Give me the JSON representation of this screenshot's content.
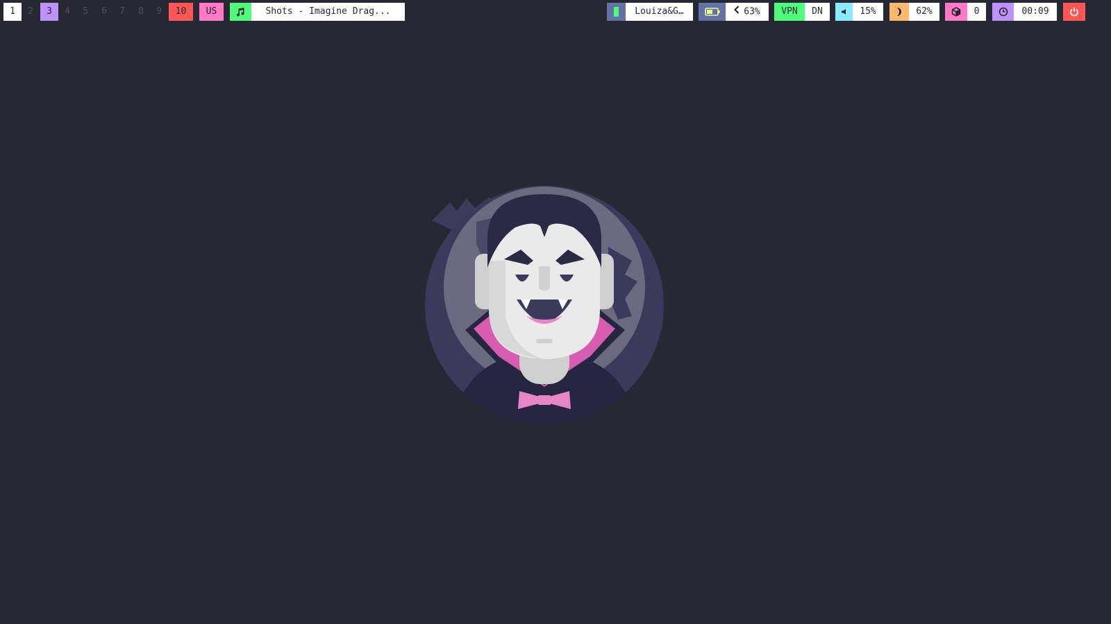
{
  "workspaces": [
    {
      "label": "1",
      "state": "focused",
      "color": "#ffffff"
    },
    {
      "label": "2",
      "state": "empty"
    },
    {
      "label": "3",
      "state": "occupied",
      "color": "#bd93f9"
    },
    {
      "label": "4",
      "state": "empty"
    },
    {
      "label": "5",
      "state": "empty"
    },
    {
      "label": "6",
      "state": "empty"
    },
    {
      "label": "7",
      "state": "empty"
    },
    {
      "label": "8",
      "state": "empty"
    },
    {
      "label": "9",
      "state": "empty"
    },
    {
      "label": "10",
      "state": "urgent",
      "color": "#ff5555"
    }
  ],
  "keyboard_layout": {
    "label": "US",
    "color": "#ff79c6"
  },
  "music": {
    "icon": "music-note-icon",
    "title": "Shots - Imagine Drag...",
    "color": "#50fa7b"
  },
  "network": {
    "icon": "wifi-signal-icon",
    "ssid": "Louiza&G…",
    "color": "#6272a4"
  },
  "battery": {
    "icon": "battery-icon",
    "brightness_icon": "chevron-left-icon",
    "value": "63%",
    "color": "#6272a4"
  },
  "vpn": {
    "label": "VPN",
    "state": "DN",
    "color": "#50fa7b"
  },
  "volume": {
    "icon": "speaker-icon",
    "value": "15%",
    "color": "#8be9fd"
  },
  "brightness": {
    "icon": "moon-icon",
    "value": "62%",
    "color": "#ffb86c"
  },
  "updates": {
    "icon": "package-icon",
    "value": "0",
    "color": "#ff79c6"
  },
  "clock": {
    "icon": "clock-icon",
    "time": "00:09",
    "color": "#bd93f9"
  },
  "power": {
    "icon": "power-icon",
    "color": "#ff5555"
  },
  "wallpaper": {
    "subject": "vampire-avatar-image"
  }
}
